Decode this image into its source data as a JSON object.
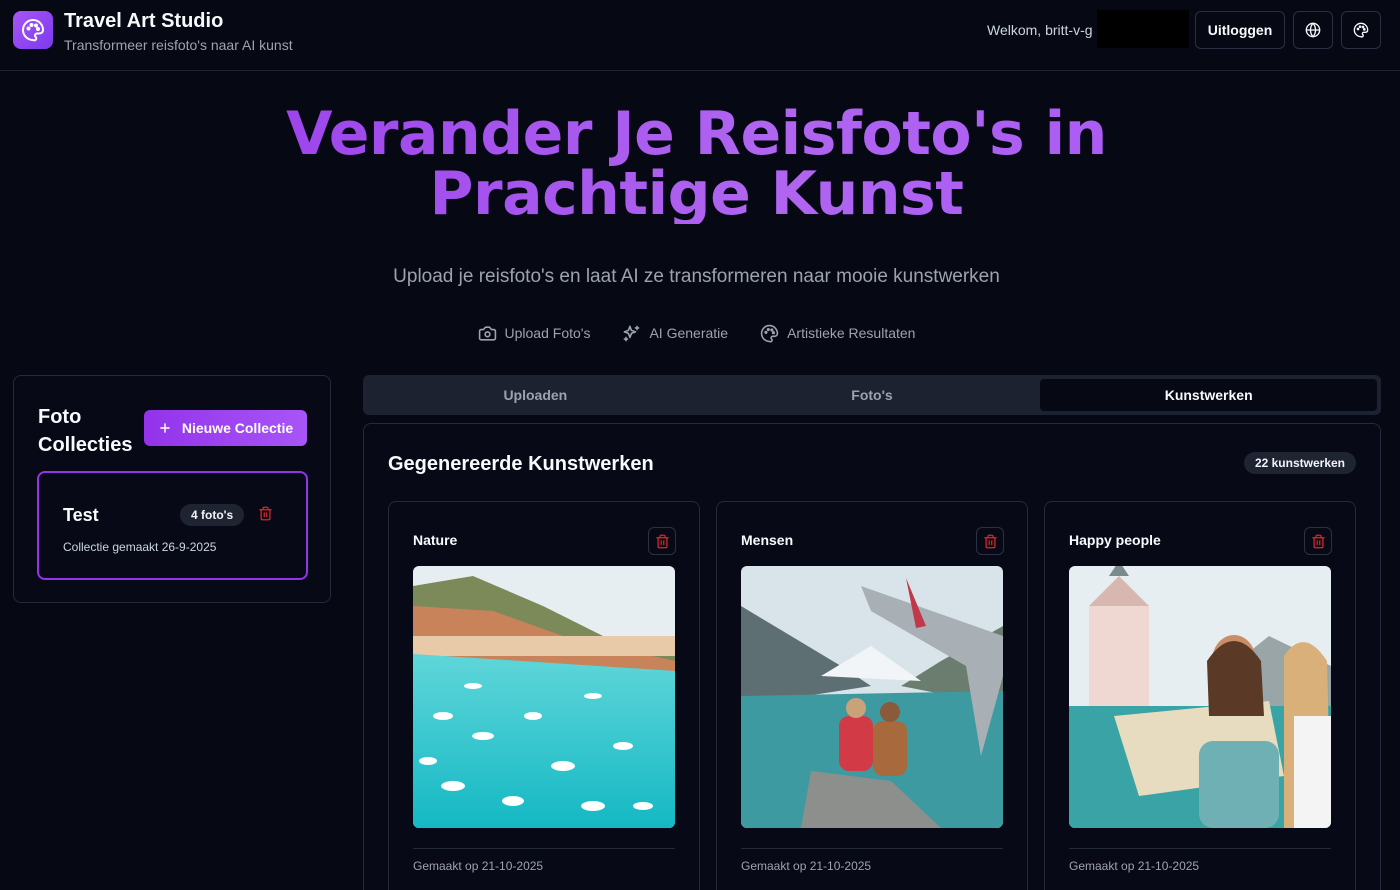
{
  "header": {
    "app_title": "Travel Art Studio",
    "app_subtitle": "Transformeer reisfoto's naar AI kunst",
    "welcome": "Welkom, britt-v-g",
    "logout_label": "Uitloggen",
    "logo_icon": "palette-icon",
    "language_icon": "globe-icon",
    "theme_icon": "palette-icon"
  },
  "hero": {
    "title_line1": "Verander Je Reisfoto's in",
    "title_line2": "Prachtige Kunst",
    "subtitle": "Upload je reisfoto's en laat AI ze transformeren naar mooie kunstwerken",
    "features": [
      {
        "label": "Upload Foto's",
        "icon": "camera-icon"
      },
      {
        "label": "AI Generatie",
        "icon": "sparkles-icon"
      },
      {
        "label": "Artistieke Resultaten",
        "icon": "palette-icon"
      }
    ]
  },
  "sidebar": {
    "title": "Foto Collecties",
    "new_button_label": "Nieuwe Collectie",
    "collections": [
      {
        "name": "Test",
        "badge": "4 foto's",
        "created": "Collectie gemaakt 26-9-2025"
      }
    ]
  },
  "tabs": [
    {
      "label": "Uploaden",
      "active": false
    },
    {
      "label": "Foto's",
      "active": false
    },
    {
      "label": "Kunstwerken",
      "active": true
    }
  ],
  "artworks_panel": {
    "title": "Gegenereerde Kunstwerken",
    "count_badge": "22 kunstwerken",
    "items": [
      {
        "title": "Nature",
        "date": "Gemaakt op 21-10-2025"
      },
      {
        "title": "Mensen",
        "date": "Gemaakt op 21-10-2025"
      },
      {
        "title": "Happy people",
        "date": "Gemaakt op 21-10-2025"
      }
    ]
  },
  "colors": {
    "background": "#060914",
    "accent": "#9333ea",
    "accent_light": "#a855f7",
    "danger": "#dc2626"
  }
}
